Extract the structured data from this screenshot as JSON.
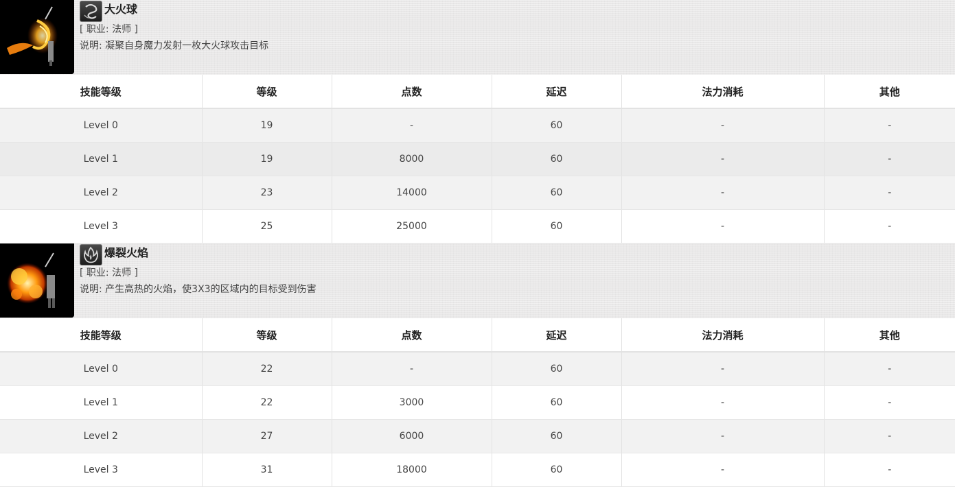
{
  "skills": [
    {
      "name": "大火球",
      "class_label": "[ 职业: 法师 ]",
      "description": "说明: 凝聚自身魔力发射一枚大火球攻击目标",
      "portrait_icon": "fireball-warrior-portrait",
      "skill_icon": "swirl-rune-icon",
      "headers": [
        "技能等级",
        "等级",
        "点数",
        "延迟",
        "法力消耗",
        "其他"
      ],
      "rows": [
        [
          "Level 0",
          "19",
          "-",
          "60",
          "-",
          "-"
        ],
        [
          "Level 1",
          "19",
          "8000",
          "60",
          "-",
          "-"
        ],
        [
          "Level 2",
          "23",
          "14000",
          "60",
          "-",
          "-"
        ],
        [
          "Level 3",
          "25",
          "25000",
          "60",
          "-",
          "-"
        ]
      ]
    },
    {
      "name": "爆裂火焰",
      "class_label": "[ 职业: 法师 ]",
      "description": "说明: 产生高热的火焰，使3X3的区域内的目标受到伤害",
      "portrait_icon": "explosion-warrior-portrait",
      "skill_icon": "flame-burst-icon",
      "headers": [
        "技能等级",
        "等级",
        "点数",
        "延迟",
        "法力消耗",
        "其他"
      ],
      "rows": [
        [
          "Level 0",
          "22",
          "-",
          "60",
          "-",
          "-"
        ],
        [
          "Level 1",
          "22",
          "3000",
          "60",
          "-",
          "-"
        ],
        [
          "Level 2",
          "27",
          "6000",
          "60",
          "-",
          "-"
        ],
        [
          "Level 3",
          "31",
          "18000",
          "60",
          "-",
          "-"
        ]
      ]
    }
  ]
}
